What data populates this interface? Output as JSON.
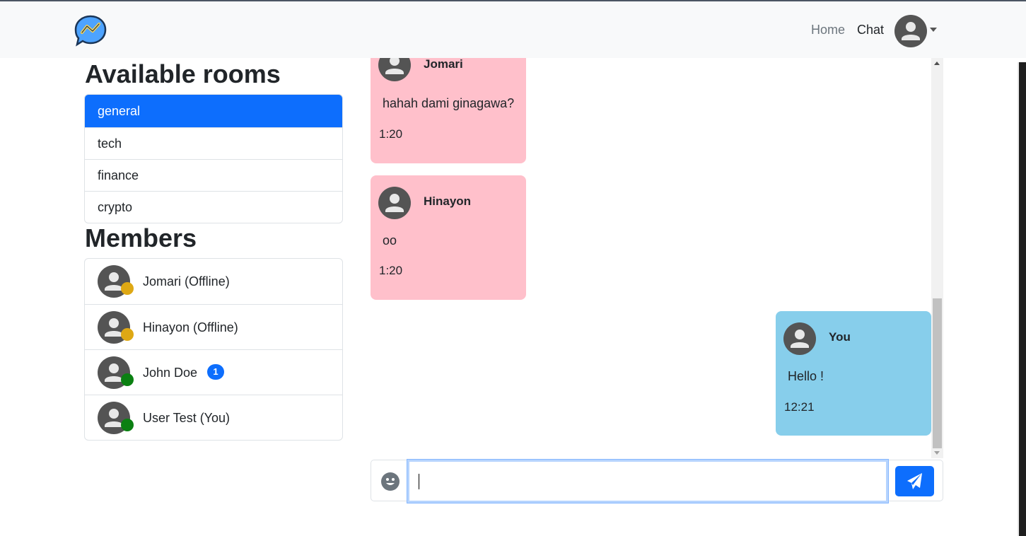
{
  "navbar": {
    "links": [
      "Home",
      "Chat"
    ],
    "logo_icon": "chat-logo-icon",
    "profile_icon": "user-avatar-icon"
  },
  "sidebar": {
    "rooms_title": "Available rooms",
    "rooms": [
      {
        "label": "general",
        "active": true
      },
      {
        "label": "tech",
        "active": false
      },
      {
        "label": "finance",
        "active": false
      },
      {
        "label": "crypto",
        "active": false
      }
    ],
    "members_title": "Members",
    "members": [
      {
        "name": "Jomari (Offline)",
        "status": "offline",
        "status_color": "#dea814",
        "badge": ""
      },
      {
        "name": "Hinayon (Offline)",
        "status": "offline",
        "status_color": "#dea814",
        "badge": ""
      },
      {
        "name": "John Doe",
        "status": "online",
        "status_color": "#0b8012",
        "badge": "1"
      },
      {
        "name": "User Test (You)",
        "status": "online",
        "status_color": "#0b8012",
        "badge": ""
      }
    ]
  },
  "messages": [
    {
      "author": "Jomari",
      "text": "hahah dami ginagawa?",
      "time": "1:20",
      "side": "left",
      "color": "#ffc0cb"
    },
    {
      "author": "Hinayon",
      "text": "oo",
      "time": "1:20",
      "side": "left",
      "color": "#ffc0cb"
    },
    {
      "author": "You",
      "text": "Hello !",
      "time": "12:21",
      "side": "right",
      "color": "#87ceeb"
    }
  ],
  "composer": {
    "value": "",
    "emoji_icon": "smiley-icon",
    "send_icon": "paper-plane-icon"
  },
  "colors": {
    "primary": "#0d6efd",
    "navbar_bg": "#f8f9fa"
  }
}
